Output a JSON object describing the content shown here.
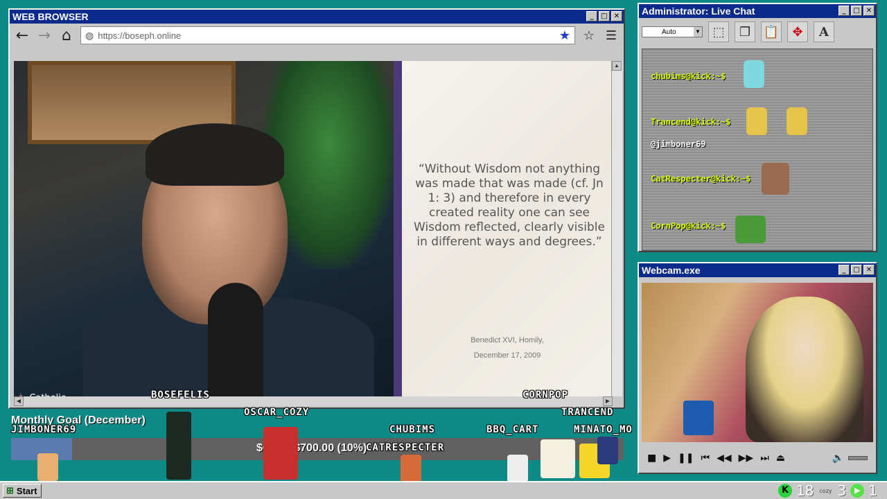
{
  "browser": {
    "title": "WEB BROWSER",
    "url": "https://boseph.online",
    "video": {
      "watermark": "Catholic",
      "quote": "“Without Wisdom not anything was made that was made (cf. Jn 1: 3) and therefore in every created reality one can see Wisdom reflected, clearly visible in different ways and degrees.”",
      "citation_line1": "Benedict XVI, Homily,",
      "citation_line2": "December 17, 2009"
    }
  },
  "chat": {
    "title": "Administrator: Live Chat",
    "select_value": "Auto",
    "messages": [
      {
        "user": "chubims@kick:~$",
        "type": "user"
      },
      {
        "user": "Trancend@kick:~$",
        "type": "user"
      },
      {
        "user": "@jimboner69",
        "type": "mention"
      },
      {
        "user": "CatRespecter@kick:~$",
        "type": "user"
      },
      {
        "user": "CornPop@kick:~$",
        "type": "user"
      }
    ]
  },
  "webcam": {
    "title": "Webcam.exe"
  },
  "overlay": {
    "goal_title": "Monthly Goal (December)",
    "goal_text": "$6?.00/$700.00 (10%)",
    "goal_progress": 0.1,
    "names": [
      "BOSEFELIS",
      "CORNPOP",
      "OSCAR_COZY",
      "JIMBONER69",
      "CHUBIMS",
      "BBQ_CART",
      "TRANCEND",
      "MINATO_MO",
      "CATRESPECTER"
    ]
  },
  "taskbar": {
    "start_label": "Start",
    "count_a": "18",
    "count_b": "3",
    "count_c": "1",
    "cozy_label": "cozy"
  }
}
